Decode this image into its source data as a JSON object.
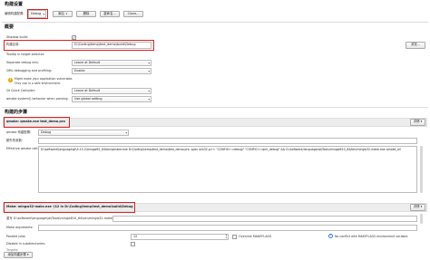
{
  "build_settings": {
    "title": "构建设置",
    "config_label": "编辑构建配置:",
    "config_value": "Debug",
    "add_button": "添加",
    "delete_button": "删除",
    "rename_button": "重命名...",
    "clone_button": "Clone..."
  },
  "general": {
    "title": "概要",
    "shadow_build_label": "Shadow build:",
    "shadow_build_checked": "✓",
    "build_dir_label": "构建目录:",
    "build_dir_value": "D:\\Coding\\temp\\test_demo\\build\\Debug",
    "browse_button": "浏览...",
    "tooltip_note": "Tooltip in target selector:",
    "separate_debug_label": "Separate debug info:",
    "separate_debug_value": "Leave at Default",
    "qml_debug_label": "QML debugging and profiling:",
    "qml_debug_value": "Enable",
    "warning_line1": "Might make your application vulnerable.",
    "warning_line2": "Only use in a safe environment.",
    "qt_quick_label": "Qt Quick Compiler:",
    "qt_quick_value": "Leave at Default",
    "qmake_behavior_label": "qmake system() behavior when parsing:",
    "qmake_behavior_value": "Use global setting"
  },
  "build_steps": {
    "title": "构建的步骤",
    "qmake_summary": "qmake: qmake.exe test_demo.pro",
    "details_button": "详情 ▾",
    "qmake_config_label": "qmake 构建配置:",
    "qmake_config_value": "Debug",
    "extra_args_label": "额外的参数:",
    "effective_call_label": "Effective qmake call:",
    "effective_call_value": "D:\\software\\language\\qt\\5.15.2\\mingw81_64\\bin\\qmake.exe D:\\Coding\\temp\\test_demo\\test_demo.pro -spec win32-g++ \"CONFIG+=debug\" \"CONFIG+=qml_debug\" && D:/software/language/qt/Tools/mingw810_64/bin/mingw32-make.exe qmake_all",
    "make_summary": "Make: mingw32-make.exe -j12 in D:\\Coding\\temp\\test_demo\\build\\Debug",
    "details_button2": "详情 ▾",
    "override_label": "重写 D:\\software\\language\\qt\\Tools\\mingw810_64\\bin\\mingw32-make.exe:",
    "make_args_label": "Make arguments:",
    "parallel_label": "Parallel jobs:",
    "parallel_value": "12",
    "override_makeflags_label": "Override MAKEFLAGS",
    "makeflags_note": "No conflict with MAKEFLAGS environment variable.",
    "disable_subdirs_label": "Disable in subdirectories:",
    "targets_label": "Targets:",
    "add_step_button": "添加构建步骤 ▾"
  },
  "colors": {
    "highlight": "#e02020",
    "band": "#ededed",
    "warning": "#f0a000"
  }
}
